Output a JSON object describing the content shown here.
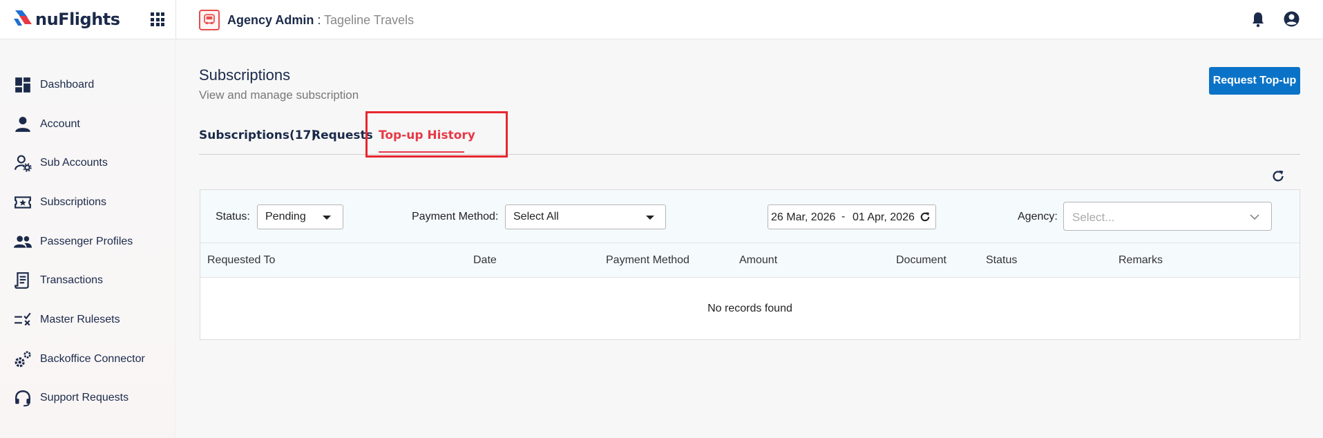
{
  "app": {
    "brand": "nuFlights",
    "agency_label": "Agency Admin",
    "agency_separator": " : ",
    "agency_name": "Tageline Travels"
  },
  "sidebar": {
    "items": [
      {
        "label": "Dashboard",
        "icon": "dashboard-icon"
      },
      {
        "label": "Account",
        "icon": "person-icon"
      },
      {
        "label": "Sub Accounts",
        "icon": "user-gear-icon"
      },
      {
        "label": "Subscriptions",
        "icon": "ticket-star-icon"
      },
      {
        "label": "Passenger Profiles",
        "icon": "people-icon"
      },
      {
        "label": "Transactions",
        "icon": "receipt-icon"
      },
      {
        "label": "Master Rulesets",
        "icon": "checklist-icon"
      },
      {
        "label": "Backoffice Connector",
        "icon": "gears-icon"
      },
      {
        "label": "Support Requests",
        "icon": "headset-icon"
      }
    ]
  },
  "page": {
    "title": "Subscriptions",
    "subtitle": "View and manage subscription",
    "request_button": "Request Top-up"
  },
  "tabs": [
    {
      "label": "Subscriptions(17)",
      "active": false
    },
    {
      "label": "Requests",
      "active": false
    },
    {
      "label": "Top-up History",
      "active": true
    }
  ],
  "filters": {
    "status_label": "Status:",
    "status_value": "Pending",
    "payment_label": "Payment Method:",
    "payment_value": "Select All",
    "date_from": "26 Mar, 2026",
    "date_sep": "-",
    "date_to": "01 Apr, 2026",
    "agency_label": "Agency:",
    "agency_placeholder": "Select..."
  },
  "table": {
    "columns": [
      "Requested To",
      "Date",
      "Payment Method",
      "Amount",
      "Document",
      "Status",
      "Remarks"
    ],
    "empty_message": "No records found"
  },
  "colors": {
    "accent": "#0b73c7",
    "active_tab": "#e63946",
    "highlight": "#e8262f",
    "navy": "#1b2a4a"
  }
}
